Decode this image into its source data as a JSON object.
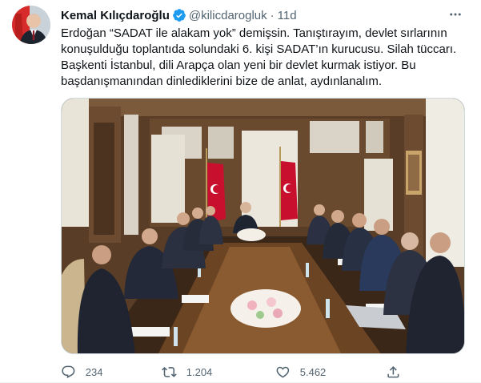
{
  "tweet": {
    "author": {
      "display_name": "Kemal Kılıçdaroğlu",
      "handle": "@kilicdarogluk",
      "verified": true,
      "avatar_icon": "profile-photo"
    },
    "separator": "·",
    "timestamp": "11d",
    "text_lines": [
      "Erdoğan “SADAT ile alakam yok” demişsin. Tanıştırayım, devlet sırlarının",
      "konuşulduğu toplantıda solundaki 6. kişi SADAT’ın kurucusu. Silah tüccarı.",
      "Başkenti İstanbul, dili Arapça olan yeni bir devlet kurmak istiyor. Bu",
      "başdanışmanından dinlediklerini bize de anlat, aydınlanalım."
    ],
    "media": {
      "type": "photo",
      "icon": "meeting-photo"
    },
    "actions": {
      "reply_count": "234",
      "retweet_count": "1.204",
      "like_count": "5.462"
    }
  },
  "colors": {
    "text": "#0f1419",
    "secondary": "#536471",
    "verified": "#1d9bf0",
    "border": "#cfd9de"
  }
}
